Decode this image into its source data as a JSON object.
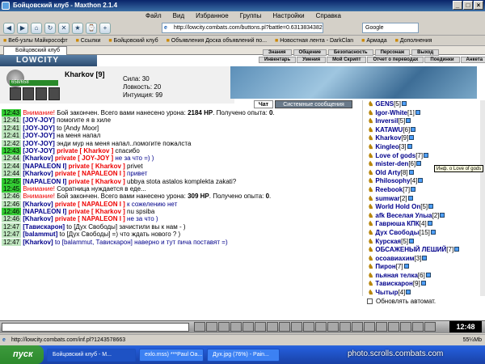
{
  "window": {
    "title": "Бойцовский клуб - Maxthon 2.1.4"
  },
  "menu": [
    "Файл",
    "Вид",
    "Избранное",
    "Группы",
    "Настройки",
    "Справка"
  ],
  "toolbar": {
    "address": "http://lowcity.combats.com/buttons.pl?battle=0.631383438278799",
    "search": "Google"
  },
  "favorites": [
    "Веб-узлы Майкрософт",
    "Ссылки",
    "Бойцовский клуб",
    "Объявления Доска объявлений по...",
    "Новостная лента - DarkClan",
    "Армада",
    "Дополнения"
  ],
  "tab": {
    "label": "Бойцовский клуб"
  },
  "game": {
    "logo": "LOWCITY",
    "nav_top": [
      "Знания",
      "Общение",
      "Безопасность",
      "Персонаж",
      "Выход"
    ],
    "nav_bottom": [
      "Инвентарь",
      "Умения",
      "Мой Скрипт",
      "Отчет о переводах",
      "Поединки",
      "Анкета"
    ],
    "character": {
      "name": "Kharkov",
      "level": "[9]",
      "hp": "658/658"
    },
    "stats": [
      "Сила: 30",
      "Ловкость: 20",
      "Интуиция: 99"
    ],
    "tabs": {
      "chat": "Чат",
      "system": "Системные сообщения"
    }
  },
  "chat": [
    {
      "time": "12:43",
      "green": true,
      "parts": [
        {
          "c": "red",
          "t": "Внимание! "
        },
        {
          "c": "",
          "t": "Бой закончен. Всего вами нанесено урона: "
        },
        {
          "c": "b",
          "t": "2184 HP"
        },
        {
          "c": "",
          "t": ". Получено опыта: "
        },
        {
          "c": "b",
          "t": "0"
        },
        {
          "c": "",
          "t": "."
        }
      ]
    },
    {
      "time": "12:41",
      "parts": [
        {
          "c": "nick",
          "t": "[JOY-JOY] "
        },
        {
          "c": "",
          "t": "помогите я в хиле"
        }
      ]
    },
    {
      "time": "12:41",
      "parts": [
        {
          "c": "nick",
          "t": "[JOY-JOY] "
        },
        {
          "c": "",
          "t": "to [Andy Moor]"
        }
      ]
    },
    {
      "time": "12:41",
      "parts": [
        {
          "c": "nick",
          "t": "[JOY-JOY] "
        },
        {
          "c": "",
          "t": "на меня напал"
        }
      ]
    },
    {
      "time": "12:42",
      "parts": [
        {
          "c": "nick",
          "t": "[JOY-JOY] "
        },
        {
          "c": "",
          "t": "энди мур на меня напал..помогите пожалста"
        }
      ]
    },
    {
      "time": "12:43",
      "green": true,
      "parts": [
        {
          "c": "nick",
          "t": "[JOY-JOY] "
        },
        {
          "c": "priv",
          "t": "private [ Kharkov ] "
        },
        {
          "c": "",
          "t": "спасибо"
        }
      ]
    },
    {
      "time": "12:44",
      "parts": [
        {
          "c": "nick",
          "t": "[Kharkov] "
        },
        {
          "c": "priv",
          "t": "private [ JOY-JOY ] "
        },
        {
          "c": "blue",
          "t": "не за что =) )"
        }
      ]
    },
    {
      "time": "12:44",
      "parts": [
        {
          "c": "nick",
          "t": "[NAPALEON I] "
        },
        {
          "c": "priv",
          "t": "private [ Kharkov ] "
        },
        {
          "c": "",
          "t": "privet"
        }
      ]
    },
    {
      "time": "12:44",
      "parts": [
        {
          "c": "nick",
          "t": "[Kharkov] "
        },
        {
          "c": "priv",
          "t": "private [ NAPALEON I ] "
        },
        {
          "c": "blue",
          "t": "привет"
        }
      ]
    },
    {
      "time": "12:45",
      "green": true,
      "parts": [
        {
          "c": "nick",
          "t": "[NAPALEON I] "
        },
        {
          "c": "priv",
          "t": "private [ Kharkov ] "
        },
        {
          "c": "",
          "t": "ubbya stota astalos komplekta zakati?"
        }
      ]
    },
    {
      "time": "12:45",
      "green": true,
      "parts": [
        {
          "c": "red",
          "t": "Внимание! "
        },
        {
          "c": "",
          "t": "Соратница нуждается в еде..."
        }
      ]
    },
    {
      "time": "12:46",
      "parts": [
        {
          "c": "red",
          "t": "Внимание! "
        },
        {
          "c": "",
          "t": "Бой закончен. Всего вами нанесено урона: "
        },
        {
          "c": "b",
          "t": "309 HP"
        },
        {
          "c": "",
          "t": ". Получено опыта: "
        },
        {
          "c": "b",
          "t": "0"
        },
        {
          "c": "",
          "t": "."
        }
      ]
    },
    {
      "time": "12:46",
      "parts": [
        {
          "c": "nick",
          "t": "[Kharkov] "
        },
        {
          "c": "priv",
          "t": "private [ NAPALEON I ] "
        },
        {
          "c": "blue",
          "t": "к сожелению нет"
        }
      ]
    },
    {
      "time": "12:46",
      "green": true,
      "parts": [
        {
          "c": "nick",
          "t": "[NAPALEON I] "
        },
        {
          "c": "priv",
          "t": "private [ Kharkov ] "
        },
        {
          "c": "",
          "t": "nu spsiba"
        }
      ]
    },
    {
      "time": "12:46",
      "parts": [
        {
          "c": "nick",
          "t": "[Kharkov] "
        },
        {
          "c": "priv",
          "t": "private [ NAPALEON I ] "
        },
        {
          "c": "blue",
          "t": "не за что )"
        }
      ]
    },
    {
      "time": "12:47",
      "parts": [
        {
          "c": "nick",
          "t": "[Тавискарон] "
        },
        {
          "c": "",
          "t": "to [Дух Свободы] зачистили вы к нам - )"
        }
      ]
    },
    {
      "time": "12:47",
      "parts": [
        {
          "c": "nick",
          "t": "[balammut] "
        },
        {
          "c": "",
          "t": "to [Дух Свободы] =) что ждать нового ? )"
        }
      ]
    },
    {
      "time": "12:47",
      "parts": [
        {
          "c": "nick",
          "t": "[Kharkov] "
        },
        {
          "c": "blue",
          "t": "to [balammut, Тавискарон] наверно и тут пича поставят =)"
        }
      ]
    }
  ],
  "users": [
    {
      "name": "GENS",
      "lvl": "[5]"
    },
    {
      "name": "Igor-White",
      "lvl": "[1]"
    },
    {
      "name": "Inversil",
      "lvl": "[5]"
    },
    {
      "name": "KATAWU",
      "lvl": "[6]"
    },
    {
      "name": "Kharkov",
      "lvl": "[9]"
    },
    {
      "name": "Kingleo",
      "lvl": "[3]"
    },
    {
      "name": "Love of gods",
      "lvl": "[7]"
    },
    {
      "name": "mister-den",
      "lvl": "[6]"
    },
    {
      "name": "Old Arty",
      "lvl": "[8]"
    },
    {
      "name": "Philosophy",
      "lvl": "[4]"
    },
    {
      "name": "Reebook",
      "lvl": "[7]"
    },
    {
      "name": "sumwar",
      "lvl": "[2]"
    },
    {
      "name": "World Hold On",
      "lvl": "[5]"
    },
    {
      "name": "afk Веселая Улыа",
      "lvl": "[2]"
    },
    {
      "name": "Гаврюша КПК",
      "lvl": "[4]"
    },
    {
      "name": "Дух Свободы",
      "lvl": "[15]"
    },
    {
      "name": "Курская",
      "lvl": "[5]"
    },
    {
      "name": "ОБСАЖЕНЫЙ ЛЕШИЙ",
      "lvl": "[7]"
    },
    {
      "name": "осоавиахим",
      "lvl": "[3]"
    },
    {
      "name": "Пирон",
      "lvl": "[7]"
    },
    {
      "name": "пьяная телка",
      "lvl": "[6]"
    },
    {
      "name": "Тавискарон",
      "lvl": "[9]"
    },
    {
      "name": "Чытыр",
      "lvl": "[4]"
    }
  ],
  "tooltip": "Инф. о Love of gods",
  "refresh_label": "Обновлять автомат.",
  "clock": "12:48",
  "status": {
    "url": "http://lowcity.combats.com/inf.pl?1243578663",
    "right": "55¼Mb"
  },
  "taskbar": {
    "start": "пуск",
    "tasks": [
      "Бойцовский клуб - M...",
      "exlo.mss) ***Paul Oa...",
      "Дух.jpg (76%) - Pain..."
    ]
  },
  "watermark": "photo.scrolls.combats.com"
}
